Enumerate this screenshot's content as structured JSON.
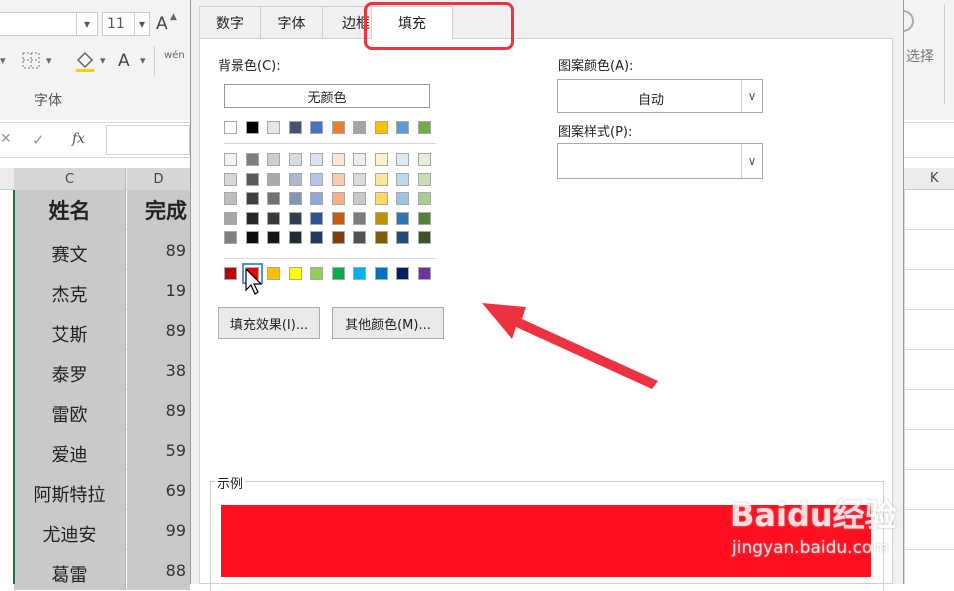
{
  "ribbon": {
    "font_size_value": "11",
    "group_label": "字体",
    "right_hint": "选择",
    "font_color_letter": "A",
    "increase_font_letter": "A",
    "phonetic_label": "wén"
  },
  "formula_bar": {
    "fx_label": "fx"
  },
  "columns": {
    "c": "C",
    "d": "D",
    "k": "K"
  },
  "sheet": {
    "header_name": "姓名",
    "header_score": "完成",
    "rows": [
      {
        "name": "赛文",
        "score": "89"
      },
      {
        "name": "杰克",
        "score": "19"
      },
      {
        "name": "艾斯",
        "score": "89"
      },
      {
        "name": "泰罗",
        "score": "38"
      },
      {
        "name": "雷欧",
        "score": "89"
      },
      {
        "name": "爱迪",
        "score": "59"
      },
      {
        "name": "阿斯特拉",
        "score": "69"
      },
      {
        "name": "尤迪安",
        "score": "99"
      },
      {
        "name": "葛雷",
        "score": "88"
      }
    ]
  },
  "dialog": {
    "tabs": [
      "数字",
      "字体",
      "边框",
      "填充"
    ],
    "active_tab": "填充",
    "background_color_label": "背景色(C):",
    "no_color_button": "无颜色",
    "pattern_color_label": "图案颜色(A):",
    "pattern_color_value": "自动",
    "pattern_style_label": "图案样式(P):",
    "pattern_style_value": "",
    "fill_effects_button": "填充效果(I)...",
    "more_colors_button": "其他颜色(M)...",
    "sample_label": "示例",
    "sample_color": "#ff1020",
    "selected_color": "#ff0000"
  },
  "palette": {
    "standard_row": [
      "#ffffff",
      "#000000",
      "#e7e6e6",
      "#44546a",
      "#4472c4",
      "#ed7d31",
      "#a5a5a5",
      "#ffc000",
      "#5b9bd5",
      "#70ad47"
    ],
    "tint_rows": [
      [
        "#f2f2f2",
        "#7f7f7f",
        "#d0cece",
        "#d6dce4",
        "#d9e2f3",
        "#fbe5d5",
        "#ededed",
        "#fff2cc",
        "#deebf6",
        "#e2efd9"
      ],
      [
        "#d8d8d8",
        "#595959",
        "#aeaaaa",
        "#adb9ca",
        "#b4c6e7",
        "#f7cbac",
        "#dbdbdb",
        "#fee599",
        "#bdd7ee",
        "#c5e0b3"
      ],
      [
        "#bfbfbf",
        "#3f3f3f",
        "#757070",
        "#8496b0",
        "#8eaadb",
        "#f4b183",
        "#c9c9c9",
        "#ffd966",
        "#9dc3e6",
        "#a8d08d"
      ],
      [
        "#a5a5a5",
        "#262626",
        "#3a3838",
        "#323f4f",
        "#2f5496",
        "#c55a11",
        "#7b7b7b",
        "#bf9000",
        "#2e75b5",
        "#538135"
      ],
      [
        "#7f7f7f",
        "#0c0c0c",
        "#171616",
        "#222a35",
        "#1f3864",
        "#833c0b",
        "#525252",
        "#7f6000",
        "#1f4e79",
        "#375623"
      ]
    ],
    "standard_colors": [
      "#c00000",
      "#ff0000",
      "#ffc000",
      "#ffff00",
      "#92d050",
      "#00b050",
      "#00b0f0",
      "#0070c0",
      "#002060",
      "#7030a0"
    ]
  },
  "annotation": {
    "arrow_color": "#ee3340",
    "highlight_color": "#ee3340"
  },
  "watermark": {
    "brand": "Baidu经验",
    "url": "jingyan.baidu.com"
  }
}
